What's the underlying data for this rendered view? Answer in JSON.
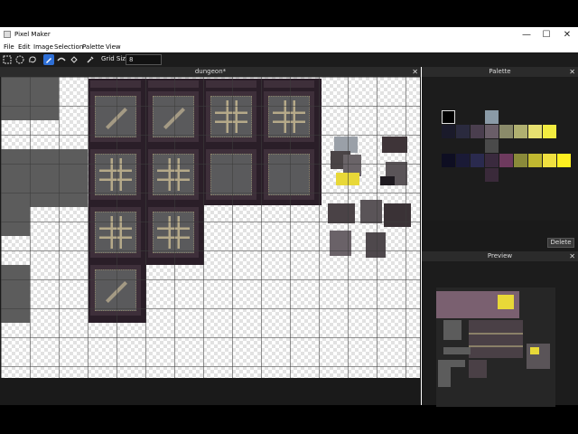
{
  "window": {
    "title": "Pixel Maker",
    "minimize": "—",
    "maximize": "☐",
    "close": "✕"
  },
  "menu": [
    "File",
    "Edit",
    "Image",
    "Selection",
    "Palette",
    "View"
  ],
  "toolbar": {
    "tools": [
      "rect-select-icon",
      "ellipse-select-icon",
      "lasso-icon",
      "pencil-icon",
      "fill-icon",
      "bucket-icon",
      "eyedropper-icon"
    ],
    "active_tool": "pencil-icon",
    "grid_size_label": "Grid Size",
    "grid_size_value": "8"
  },
  "canvas": {
    "tab_title": "dungeon*",
    "close": "✕"
  },
  "palette": {
    "title": "Palette",
    "close": "✕",
    "selected": "#000000",
    "colors": [
      "#000000",
      "#8a9aa6",
      "#1a1a2a",
      "#2a2a3e",
      "#4a3e4e",
      "#6a5e68",
      "#8a8a6a",
      "#b0b070",
      "#e6e070",
      "#f2ec40",
      "#4a4a4a",
      "#0e0e22",
      "#1a1a36",
      "#2a2a4e",
      "#3a2a3e",
      "#6e3a5e",
      "#8a8a3a",
      "#c0b830",
      "#f0e040",
      "#fff020",
      "#3a2a3a"
    ],
    "delete_label": "Delete"
  },
  "preview": {
    "title": "Preview",
    "close": "✕"
  }
}
